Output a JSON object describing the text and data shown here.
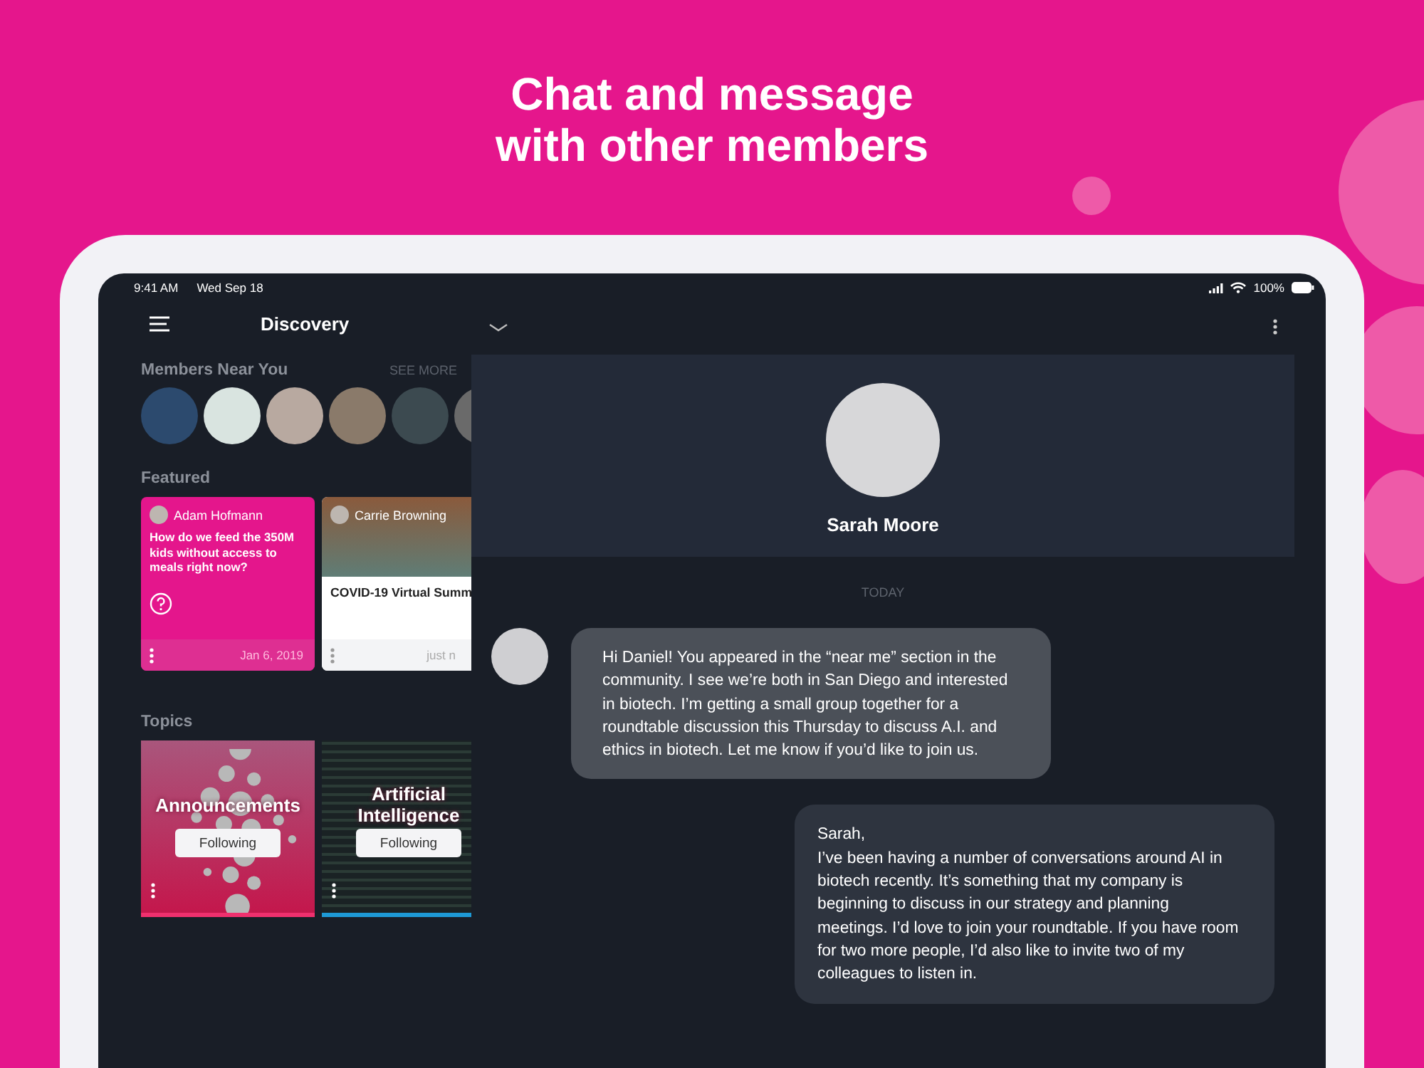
{
  "headline": [
    "Chat and message",
    "with other members"
  ],
  "status_bar": {
    "time": "9:41 AM",
    "date": "Wed Sep 18",
    "battery": "100%"
  },
  "sidebar": {
    "title": "Discovery",
    "members": {
      "heading": "Members Near You",
      "link": "SEE MORE"
    },
    "featured": {
      "heading": "Featured",
      "cards": [
        {
          "kind": "question",
          "author": "Adam Hofmann",
          "text": "How do we feed the 350M kids without access to meals right now?",
          "date": "Jan 6, 2019"
        },
        {
          "kind": "event",
          "author": "Carrie Browning",
          "text": "COVID-19 Virtual Summ",
          "date": "just n"
        }
      ]
    },
    "topics": {
      "heading": "Topics",
      "items": [
        {
          "kind": "dots",
          "name": "Announcements",
          "button": "Following",
          "color": "#f0306e"
        },
        {
          "kind": "code",
          "name": "Artificial Intelligence",
          "button": "Following",
          "color": "#1e9ad6"
        }
      ]
    }
  },
  "chat": {
    "contact": "Sarah Moore",
    "day": "TODAY",
    "messages": [
      {
        "kind": "incoming",
        "text": "Hi Daniel! You appeared in the “near me” section in the community. I see we’re both in San Diego and interested in biotech. I’m getting a small group together for a roundtable discussion this Thursday to discuss A.I. and ethics in biotech. Let me know if you’d like to join us."
      },
      {
        "kind": "outgoing",
        "text": "Sarah,\nI’ve been having a number of conversations around AI in biotech recently. It’s something that my company is beginning to discuss in our strategy and planning meetings. I’d love to join your roundtable. If you have room for two more people, I’d also like to invite two of my colleagues to listen in."
      }
    ]
  }
}
